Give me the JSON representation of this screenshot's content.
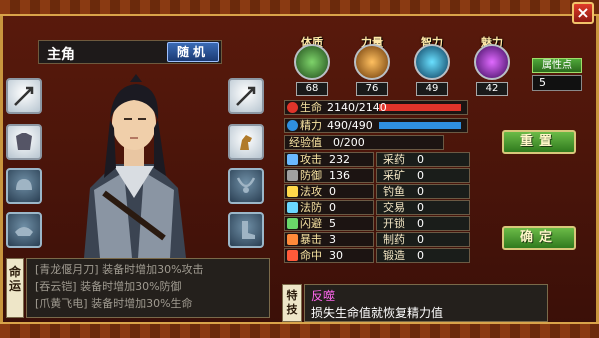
{
  "character": {
    "name": "主角",
    "random_label": "随机"
  },
  "attributes": [
    {
      "name": "体质",
      "value": "68",
      "color": "#3f8a3a"
    },
    {
      "name": "力量",
      "value": "76",
      "color": "#c0761e"
    },
    {
      "name": "智力",
      "value": "49",
      "color": "#2a8aa8"
    },
    {
      "name": "魅力",
      "value": "42",
      "color": "#8a2aa8"
    }
  ],
  "attribute_points": {
    "label": "属性点",
    "value": "5"
  },
  "bars": {
    "hp": {
      "label": "生命",
      "text": "2140/2140",
      "fill": 1.0,
      "color": "#e0342a"
    },
    "mp": {
      "label": "精力",
      "text": "490/490",
      "fill": 1.0,
      "color": "#2f8fe0"
    },
    "exp": {
      "label": "经验值",
      "text": "0/200"
    }
  },
  "combat_stats": [
    {
      "label": "攻击",
      "value": "232"
    },
    {
      "label": "防御",
      "value": "136"
    },
    {
      "label": "法攻",
      "value": "0"
    },
    {
      "label": "法防",
      "value": "0"
    },
    {
      "label": "闪避",
      "value": "5"
    },
    {
      "label": "暴击",
      "value": "3"
    },
    {
      "label": "命中",
      "value": "30"
    }
  ],
  "life_skills": [
    {
      "label": "采药",
      "value": "0"
    },
    {
      "label": "采矿",
      "value": "0"
    },
    {
      "label": "钓鱼",
      "value": "0"
    },
    {
      "label": "交易",
      "value": "0"
    },
    {
      "label": "开锁",
      "value": "0"
    },
    {
      "label": "制药",
      "value": "0"
    },
    {
      "label": "锻造",
      "value": "0"
    }
  ],
  "buttons": {
    "reset": "重置",
    "confirm": "确定"
  },
  "fate": {
    "tag": "命运",
    "lines": [
      "[青龙偃月刀] 装备时增加30%攻击",
      "[吞云铠] 装备时增加30%防御",
      "[爪黄飞电] 装备时增加30%生命"
    ]
  },
  "special": {
    "tag": "特技",
    "name": "反噬",
    "desc": "损失生命值就恢复精力值"
  },
  "close_label": "×"
}
